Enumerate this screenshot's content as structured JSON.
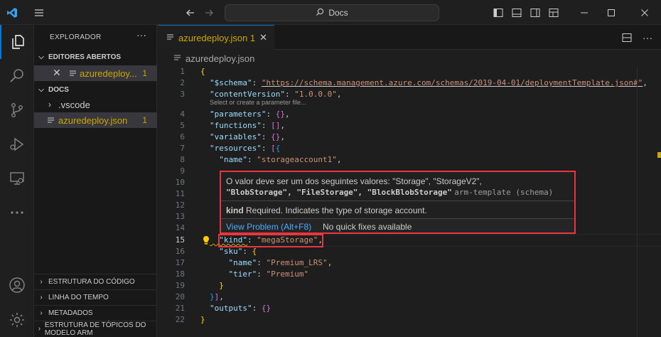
{
  "titlebar": {
    "search_text": "Docs",
    "icons": [
      "vscode-logo-icon",
      "menu-icon",
      "back-arrow-icon",
      "forward-arrow-icon",
      "search-icon",
      "toggle-sidebar-icon",
      "toggle-panel-icon",
      "toggle-secondary-sidebar-icon",
      "customize-layout-icon",
      "minimize-icon",
      "maximize-icon",
      "close-icon"
    ]
  },
  "activitybar": {
    "items": [
      "explorer-icon",
      "search-icon",
      "source-control-icon",
      "run-debug-icon",
      "remote-explorer-icon",
      "more-icon",
      "account-icon",
      "settings-gear-icon"
    ]
  },
  "sidebar": {
    "header": "EXPLORADOR",
    "open_editors": {
      "title": "EDITORES ABERTOS",
      "items": [
        {
          "label": "azuredeploy...",
          "count": "1"
        }
      ]
    },
    "folder": {
      "title": "DOCS",
      "items": [
        {
          "label": ".vscode"
        },
        {
          "label": "azuredeploy.json",
          "count": "1"
        }
      ]
    },
    "bottom_sections": [
      "ESTRUTURA DO CÓDIGO",
      "LINHA DO TEMPO",
      "METADADOS",
      "ESTRUTURA DE TÓPICOS DO MODELO ARM"
    ]
  },
  "editor": {
    "tab_label": "azuredeploy.json 1",
    "breadcrumb": "azuredeploy.json",
    "codelens": "Select or create a parameter file...",
    "current_line": 15,
    "lines": [
      {
        "n": "1",
        "t": [
          [
            "b1",
            "{"
          ]
        ]
      },
      {
        "n": "2",
        "t": [
          [
            "k",
            "\"$schema\""
          ],
          [
            "p",
            ": "
          ],
          [
            "su",
            "\"https://schema.management.azure.com/schemas/2019-04-01/deploymentTemplate.json#\""
          ],
          [
            "p",
            ","
          ]
        ]
      },
      {
        "n": "3",
        "t": [
          [
            "k",
            "\"contentVersion\""
          ],
          [
            "p",
            ": "
          ],
          [
            "s",
            "\"1.0.0.0\""
          ],
          [
            "p",
            ","
          ]
        ]
      },
      {
        "n": "4",
        "t": [
          [
            "k",
            "\"parameters\""
          ],
          [
            "p",
            ": "
          ],
          [
            "b2",
            "{}"
          ],
          [
            "p",
            ","
          ]
        ]
      },
      {
        "n": "5",
        "t": [
          [
            "k",
            "\"functions\""
          ],
          [
            "p",
            ": "
          ],
          [
            "b2",
            "[]"
          ],
          [
            "p",
            ","
          ]
        ]
      },
      {
        "n": "6",
        "t": [
          [
            "k",
            "\"variables\""
          ],
          [
            "p",
            ": "
          ],
          [
            "b2",
            "{}"
          ],
          [
            "p",
            ","
          ]
        ]
      },
      {
        "n": "7",
        "t": [
          [
            "k",
            "\"resources\""
          ],
          [
            "p",
            ": "
          ],
          [
            "b2",
            "["
          ],
          [
            "b3",
            "{"
          ]
        ]
      },
      {
        "n": "8",
        "t": [
          [
            "k",
            "  \"name\""
          ],
          [
            "p",
            ": "
          ],
          [
            "s",
            "\"storageaccount1\""
          ],
          [
            "p",
            ","
          ]
        ]
      },
      {
        "n": "9",
        "t": []
      },
      {
        "n": "10",
        "t": []
      },
      {
        "n": "11",
        "t": []
      },
      {
        "n": "12",
        "t": []
      },
      {
        "n": "13",
        "t": []
      },
      {
        "n": "14",
        "t": []
      },
      {
        "n": "15",
        "t": [
          [
            "kw",
            "  \"kind\""
          ],
          [
            "p",
            ": "
          ],
          [
            "s",
            "\"megaStorage\""
          ],
          [
            "p",
            ","
          ]
        ]
      },
      {
        "n": "16",
        "t": [
          [
            "k",
            "  \"sku\""
          ],
          [
            "p",
            ": "
          ],
          [
            "b1",
            "{"
          ]
        ]
      },
      {
        "n": "17",
        "t": [
          [
            "k",
            "    \"name\""
          ],
          [
            "p",
            ": "
          ],
          [
            "s",
            "\"Premium_LRS\""
          ],
          [
            "p",
            ","
          ]
        ]
      },
      {
        "n": "18",
        "t": [
          [
            "k",
            "    \"tier\""
          ],
          [
            "p",
            ": "
          ],
          [
            "s",
            "\"Premium\""
          ]
        ]
      },
      {
        "n": "19",
        "t": [
          [
            "b1",
            "  }"
          ]
        ]
      },
      {
        "n": "20",
        "t": [
          [
            "b3",
            "}"
          ],
          [
            "b2",
            "]"
          ],
          [
            "p",
            ","
          ]
        ]
      },
      {
        "n": "21",
        "t": [
          [
            "k",
            "\"outputs\""
          ],
          [
            "p",
            ": "
          ],
          [
            "b2",
            "{}"
          ]
        ]
      },
      {
        "n": "22",
        "t": [
          [
            "b1",
            "}"
          ]
        ]
      }
    ]
  },
  "hover": {
    "message_part1": "O valor deve ser um dos seguintes valores: \"Storage\", \"StorageV2\",",
    "message_part2": "\"BlobStorage\", \"FileStorage\", \"BlockBlobStorage\"",
    "source": "arm-template (schema)",
    "doc_key": "kind",
    "doc_text": "Required. Indicates the type of storage account.",
    "view_problem": "View Problem (Alt+F8)",
    "no_quick_fixes": "No quick fixes available"
  },
  "colors": {
    "warning": "#cca700",
    "accent": "#0078d4",
    "highlight_box": "#e8353f",
    "link": "#4daafc"
  }
}
